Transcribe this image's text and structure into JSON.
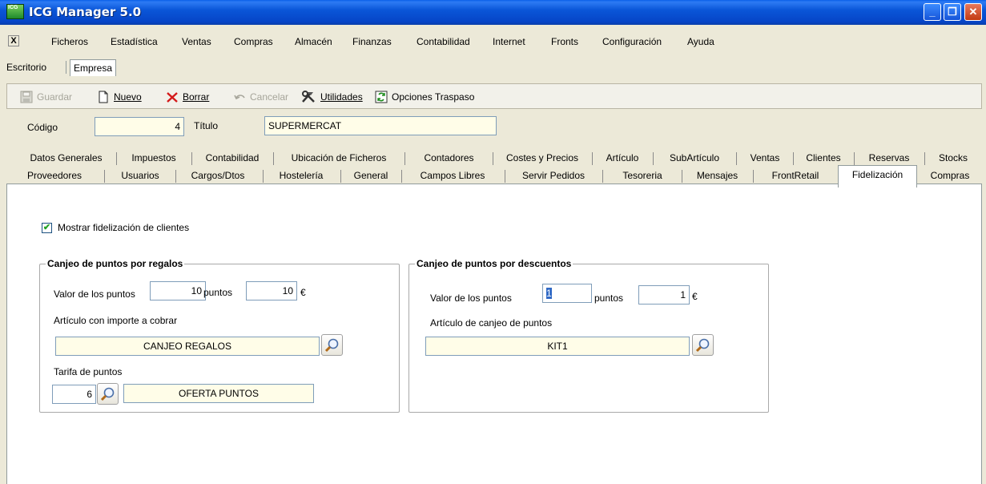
{
  "window": {
    "app_icon_text": "ICG",
    "title": "ICG Manager 5.0",
    "controls": {
      "minimize": "_",
      "restore": "❐",
      "close": "✕"
    }
  },
  "menu": {
    "close_glyph": "X",
    "items": [
      "Ficheros",
      "Estadística",
      "Ventas",
      "Compras",
      "Almacén",
      "Finanzas",
      "Contabilidad",
      "Internet",
      "Fronts",
      "Configuración",
      "Ayuda"
    ]
  },
  "top_tabs": [
    "Escritorio",
    "Empresa"
  ],
  "toolbar": {
    "guardar": "Guardar",
    "nuevo": "Nuevo",
    "borrar": "Borrar",
    "cancelar": "Cancelar",
    "utilidades": "Utilidades",
    "opciones_traspaso": "Opciones Traspaso"
  },
  "header": {
    "codigo_label": "Código",
    "codigo_value": "4",
    "titulo_label": "Título",
    "titulo_value": "SUPERMERCAT"
  },
  "tabs_row1": [
    "Datos Generales",
    "Impuestos",
    "Contabilidad",
    "Ubicación de Ficheros",
    "Contadores",
    "Costes y Precios",
    "Artículo",
    "SubArtículo",
    "Ventas",
    "Clientes",
    "Reservas",
    "Stocks"
  ],
  "tabs_row2": [
    "Proveedores",
    "Usuarios",
    "Cargos/Dtos",
    "Hostelería",
    "General",
    "Campos Libres",
    "Servir Pedidos",
    "Tesoreria",
    "Mensajes",
    "FrontRetail",
    "Fidelización",
    "Compras"
  ],
  "fidelizacion": {
    "show_checkbox_label": "Mostrar fidelización de clientes",
    "show_checkbox_checked": true,
    "regalos": {
      "title": "Canjeo de puntos por regalos",
      "valor_label": "Valor de los puntos",
      "puntos_value": "10",
      "puntos_unit": "puntos",
      "euros_value": "10",
      "currency": "€",
      "articulo_label": "Artículo con importe a cobrar",
      "articulo_value": "CANJEO REGALOS",
      "tarifa_label": "Tarifa de puntos",
      "tarifa_code": "6",
      "tarifa_name": "OFERTA PUNTOS"
    },
    "descuentos": {
      "title": "Canjeo de puntos por descuentos",
      "valor_label": "Valor de los puntos",
      "puntos_value": "1",
      "puntos_unit": "puntos",
      "euros_value": "1",
      "currency": "€",
      "articulo_label": "Artículo de canjeo de puntos",
      "articulo_value": "KIT1"
    }
  }
}
